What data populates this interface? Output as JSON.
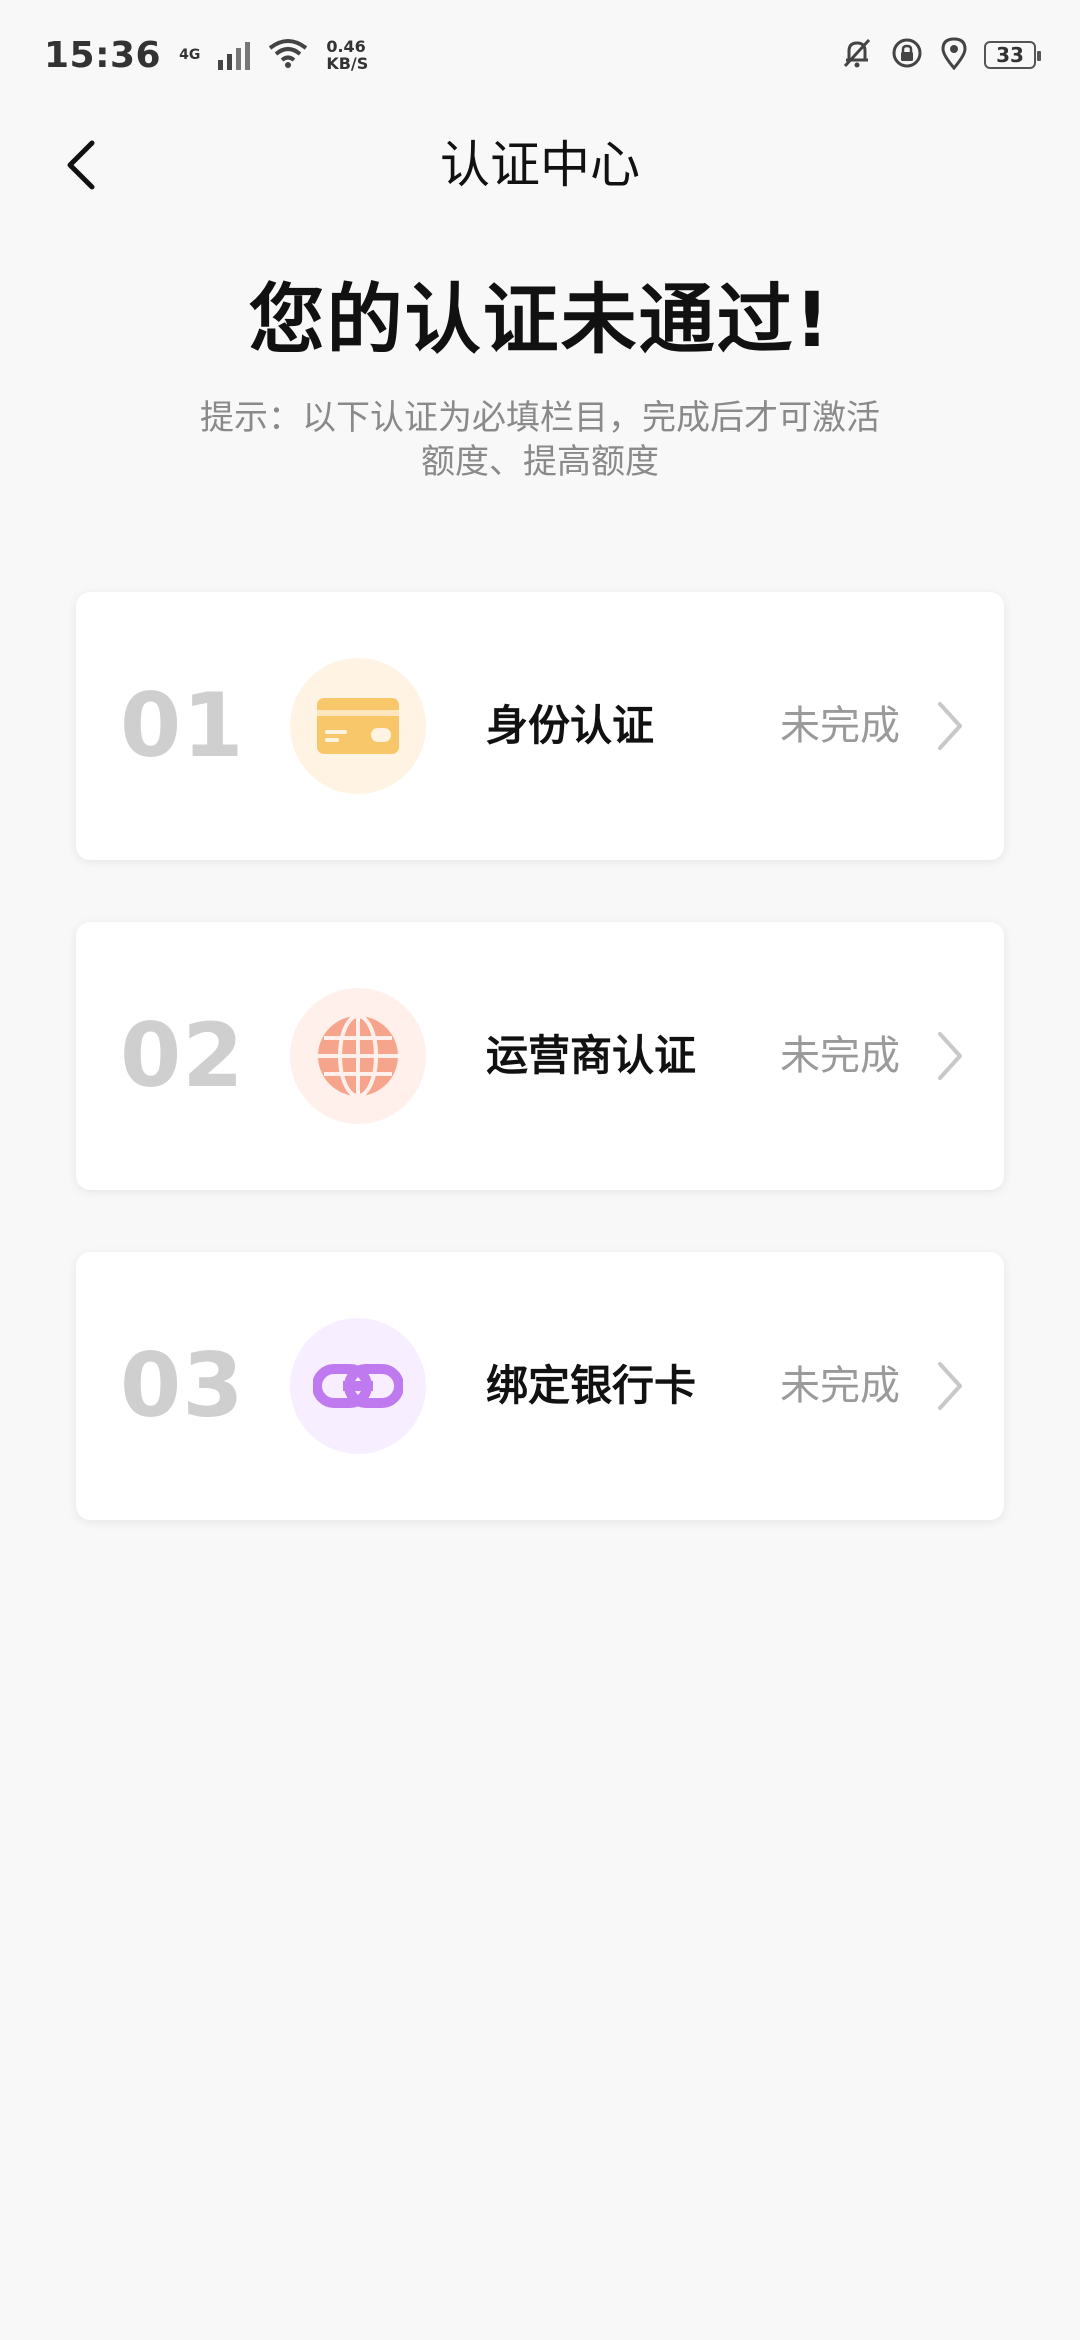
{
  "status_bar": {
    "time": "15:36",
    "network": "4G",
    "speed_value": "0.46",
    "speed_unit": "KB/S",
    "battery": "33"
  },
  "app_bar": {
    "title": "认证中心",
    "back_icon": "chevron-left-icon"
  },
  "headline": "您的认证未通过!",
  "tip": "提示：以下认证为必填栏目，完成后才可激活额度、提高额度",
  "items": [
    {
      "number": "01",
      "label": "身份认证",
      "status": "未完成",
      "icon": "id-card-icon",
      "icon_bg": "#fff4e3",
      "icon_color": "#f8c76a"
    },
    {
      "number": "02",
      "label": "运营商认证",
      "status": "未完成",
      "icon": "globe-icon",
      "icon_bg": "#fff0ec",
      "icon_color": "#f7a48d"
    },
    {
      "number": "03",
      "label": "绑定银行卡",
      "status": "未完成",
      "icon": "link-icon",
      "icon_bg": "#f7efff",
      "icon_color": "#c07af0"
    }
  ],
  "colors": {
    "background": "#f8f8f8",
    "number_gray": "#cfcfcf",
    "status_gray": "#9a9a9a"
  }
}
